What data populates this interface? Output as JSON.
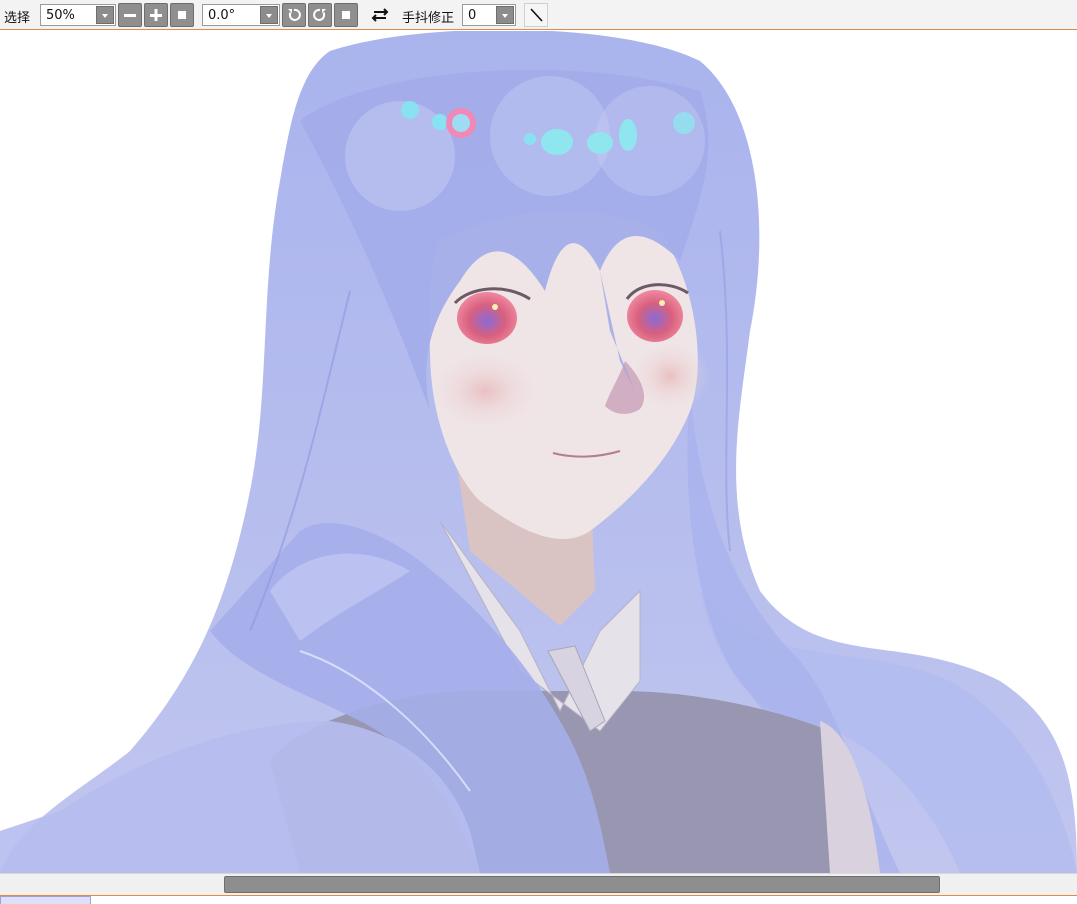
{
  "toolbar": {
    "select_label": "选择",
    "zoom_value": "50%",
    "rotation_value": "0.0°",
    "stabilizer_label": "手抖修正",
    "stabilizer_value": "0",
    "icons": {
      "zoom_out": "minus-icon",
      "zoom_in": "plus-icon",
      "zoom_reset": "square-icon",
      "rotate_ccw": "rotate-ccw-icon",
      "rotate_cw": "rotate-cw-icon",
      "rotate_reset": "square-icon",
      "flip": "flip-horizontal-icon",
      "line": "diagonal-line-icon"
    }
  },
  "canvas": {
    "artwork": "illustration of a girl with long blue hair and red eyes"
  },
  "colors": {
    "accent_line": "#e08a4c",
    "hair": "#a7b0ea",
    "eye": "#e0506e",
    "vest": "#9a98b0"
  }
}
